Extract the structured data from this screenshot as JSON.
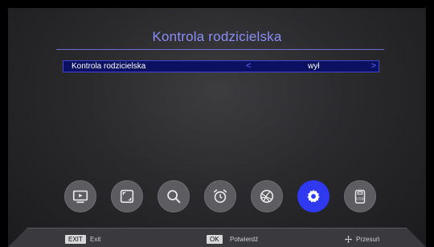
{
  "header": {
    "title": "Kontrola rodzicielska"
  },
  "setting": {
    "label": "Kontrola rodzicielska",
    "value": "wył",
    "arrow_left": "<",
    "arrow_right": ">"
  },
  "menu": {
    "items": [
      {
        "name": "tv-icon",
        "active": false
      },
      {
        "name": "picture-icon",
        "active": false
      },
      {
        "name": "search-icon",
        "active": false
      },
      {
        "name": "alarm-clock-icon",
        "active": false
      },
      {
        "name": "network-icon",
        "active": false
      },
      {
        "name": "settings-gear-icon",
        "active": true
      },
      {
        "name": "usb-icon",
        "active": false
      }
    ],
    "accent_color": "#2f39f2"
  },
  "footer": {
    "exit_key": "EXIT",
    "exit_label": "Exit",
    "ok_key": "OK",
    "ok_label": "Potwierdź",
    "move_label": "Przesuń"
  }
}
